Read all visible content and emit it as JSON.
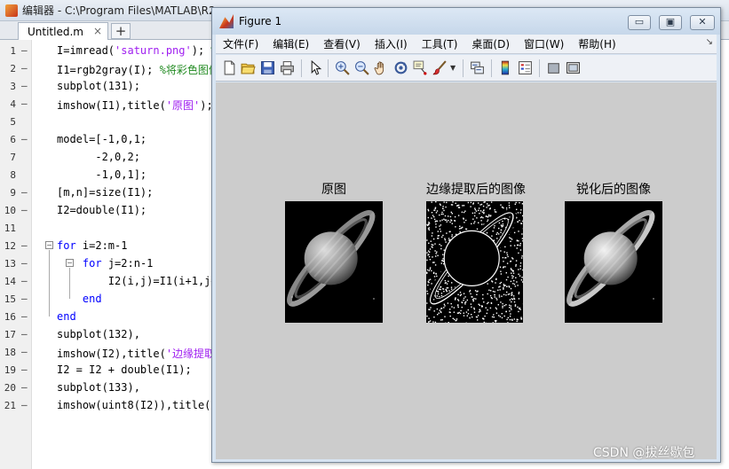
{
  "editor": {
    "title": "编辑器 - C:\\Program Files\\MATLAB\\R2",
    "tab_label": "Untitled.m",
    "tab_close": "×",
    "new_tab": "+",
    "lines": [
      {
        "n": "1",
        "dash": "–",
        "code": "I=imread('saturn.png'); %"
      },
      {
        "n": "2",
        "dash": "–",
        "code": "I1=rgb2gray(I); %将彩色图像"
      },
      {
        "n": "3",
        "dash": "–",
        "code": "subplot(131);"
      },
      {
        "n": "4",
        "dash": "–",
        "code": "imshow(I1),title('原图');"
      },
      {
        "n": "5",
        "dash": "",
        "code": ""
      },
      {
        "n": "6",
        "dash": "–",
        "code": "model=[-1,0,1;"
      },
      {
        "n": "7",
        "dash": "",
        "code": "      -2,0,2;"
      },
      {
        "n": "8",
        "dash": "",
        "code": "      -1,0,1];"
      },
      {
        "n": "9",
        "dash": "–",
        "code": "[m,n]=size(I1);"
      },
      {
        "n": "10",
        "dash": "–",
        "code": "I2=double(I1);"
      },
      {
        "n": "11",
        "dash": "",
        "code": ""
      },
      {
        "n": "12",
        "dash": "–",
        "code": "for i=2:m-1"
      },
      {
        "n": "13",
        "dash": "–",
        "code": "    for j=2:n-1"
      },
      {
        "n": "14",
        "dash": "–",
        "code": "        I2(i,j)=I1(i+1,j+"
      },
      {
        "n": "15",
        "dash": "–",
        "code": "    end"
      },
      {
        "n": "16",
        "dash": "–",
        "code": "end"
      },
      {
        "n": "17",
        "dash": "–",
        "code": "subplot(132),"
      },
      {
        "n": "18",
        "dash": "–",
        "code": "imshow(I2),title('边缘提取"
      },
      {
        "n": "19",
        "dash": "–",
        "code": "I2 = I2 + double(I1);"
      },
      {
        "n": "20",
        "dash": "–",
        "code": "subplot(133),"
      },
      {
        "n": "21",
        "dash": "–",
        "code": "imshow(uint8(I2)),title('"
      }
    ]
  },
  "figure": {
    "title": "Figure 1",
    "window_buttons": {
      "minimize": "▭",
      "maximize": "▣",
      "close": "✕"
    },
    "menu": [
      "文件(F)",
      "编辑(E)",
      "查看(V)",
      "插入(I)",
      "工具(T)",
      "桌面(D)",
      "窗口(W)",
      "帮助(H)"
    ],
    "menu_dock": "↘",
    "toolbar_icons": [
      "new-figure-icon",
      "open-file-icon",
      "save-icon",
      "print-icon",
      "select-pointer-icon",
      "zoom-in-icon",
      "zoom-out-icon",
      "pan-hand-icon",
      "rotate-3d-icon",
      "data-cursor-icon",
      "brush-icon",
      "link-plot-icon",
      "colorbar-icon",
      "legend-icon",
      "hide-plot-tools-icon",
      "show-plot-tools-icon"
    ],
    "subplots": [
      {
        "title": "原图",
        "kind": "original"
      },
      {
        "title": "边缘提取后的图像",
        "kind": "edges"
      },
      {
        "title": "锐化后的图像",
        "kind": "sharpened"
      }
    ],
    "canvas_color": "#cccccc"
  },
  "watermark": "CSDN @拔丝歇包"
}
